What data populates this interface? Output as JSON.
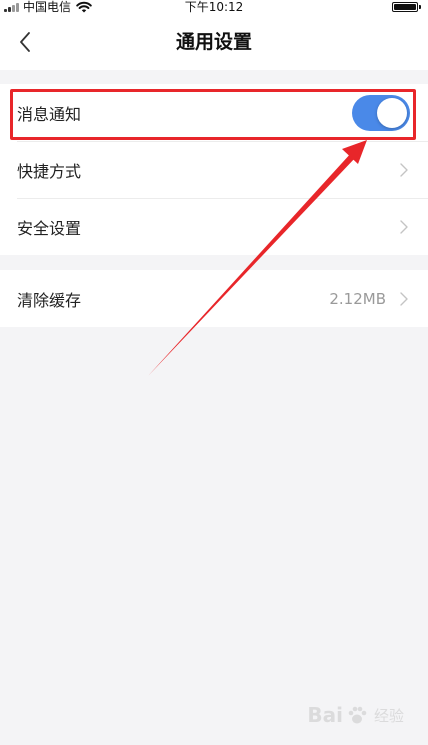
{
  "status_bar": {
    "carrier": "中国电信",
    "time": "下午10:12"
  },
  "nav": {
    "title": "通用设置"
  },
  "settings_group_1": [
    {
      "label": "消息通知",
      "type": "toggle",
      "enabled": true
    },
    {
      "label": "快捷方式",
      "type": "link"
    },
    {
      "label": "安全设置",
      "type": "link"
    }
  ],
  "settings_group_2": [
    {
      "label": "清除缓存",
      "value": "2.12MB",
      "type": "link"
    }
  ],
  "colors": {
    "toggle_on": "#4a89e8",
    "annotation_red": "#e8262a",
    "background": "#f4f4f6"
  },
  "watermark": {
    "brand_left": "Bai",
    "brand_right": "经验"
  }
}
